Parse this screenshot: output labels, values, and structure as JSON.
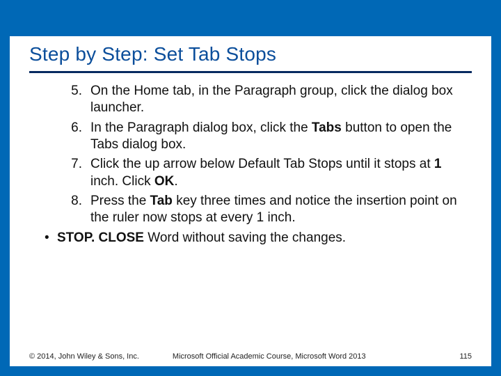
{
  "title": "Step by Step: Set Tab Stops",
  "list_start": 4,
  "steps": [
    {
      "pre": "On the Home tab, in the Paragraph group, click the dialog box launcher.",
      "bold": "",
      "post": ""
    },
    {
      "pre": "In the Paragraph dialog box, click the ",
      "bold": "Tabs",
      "post": " button to open the Tabs dialog box."
    },
    {
      "pre": "Click the up arrow below Default Tab Stops until it stops at ",
      "bold": "1",
      "post": " inch. Click ",
      "bold2": "OK",
      "post2": "."
    },
    {
      "pre": "Press the ",
      "bold": "Tab",
      "post": " key three times and notice the insertion point on the ruler now stops at every 1 inch."
    }
  ],
  "bullets": [
    {
      "bold": "STOP. CLOSE",
      "post": " Word without saving the changes."
    }
  ],
  "footer": {
    "copyright": "© 2014, John Wiley & Sons, Inc.",
    "course": "Microsoft Official Academic Course, Microsoft Word 2013",
    "page": "115"
  }
}
